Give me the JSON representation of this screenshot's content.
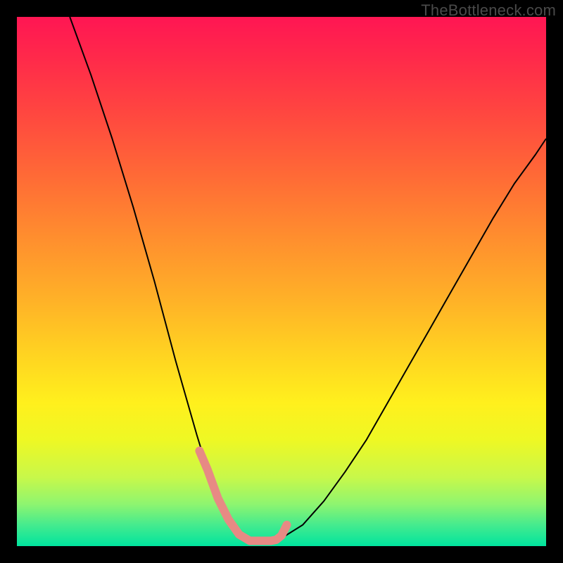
{
  "watermark": "TheBottleneck.com",
  "frame": {
    "outer_bg": "#000000",
    "inner_size_px": 752,
    "border_px": 24
  },
  "gradient_stops": [
    {
      "pct": 0,
      "color": "#ff1653"
    },
    {
      "pct": 8,
      "color": "#ff2a4a"
    },
    {
      "pct": 18,
      "color": "#ff4640"
    },
    {
      "pct": 30,
      "color": "#ff6a36"
    },
    {
      "pct": 42,
      "color": "#ff8f2e"
    },
    {
      "pct": 54,
      "color": "#ffb327"
    },
    {
      "pct": 64,
      "color": "#ffd421"
    },
    {
      "pct": 73,
      "color": "#fff01d"
    },
    {
      "pct": 80,
      "color": "#eef824"
    },
    {
      "pct": 87,
      "color": "#c8f84a"
    },
    {
      "pct": 92,
      "color": "#8ff56f"
    },
    {
      "pct": 96,
      "color": "#45eb8e"
    },
    {
      "pct": 100,
      "color": "#00e49e"
    }
  ],
  "chart_data": {
    "type": "line",
    "title": "",
    "xlabel": "",
    "ylabel": "",
    "xlim": [
      0,
      100
    ],
    "ylim": [
      0,
      100
    ],
    "note": "No axes, tick labels, or legend are rendered. x and y are normalized to the plot area (0–100). y is plotted with origin at bottom. The curve is a V-shape with a short flat bottom and a salmon highlight segment near the trough.",
    "series": [
      {
        "name": "main-curve",
        "color": "#000000",
        "stroke_width_px": 2,
        "x": [
          10,
          14,
          18,
          22,
          26,
          30,
          32,
          34,
          36,
          38,
          40,
          42,
          44,
          46,
          48,
          50,
          54,
          58,
          62,
          66,
          70,
          74,
          78,
          82,
          86,
          90,
          94,
          98,
          100
        ],
        "y": [
          100,
          89,
          77,
          64,
          50,
          35,
          28,
          21,
          14.5,
          9,
          5,
          2.2,
          1,
          1,
          1,
          1.5,
          4,
          8.5,
          14,
          20,
          27,
          34,
          41,
          48,
          55,
          62,
          68.5,
          74,
          77
        ]
      },
      {
        "name": "highlight-near-trough",
        "color": "#e78a84",
        "stroke_width_px": 12,
        "x": [
          34.5,
          36,
          38,
          40,
          42,
          44,
          46,
          48,
          49,
          50,
          51
        ],
        "y": [
          18,
          14.5,
          9,
          5,
          2.2,
          1,
          1,
          1,
          1.2,
          2,
          4
        ]
      }
    ]
  }
}
